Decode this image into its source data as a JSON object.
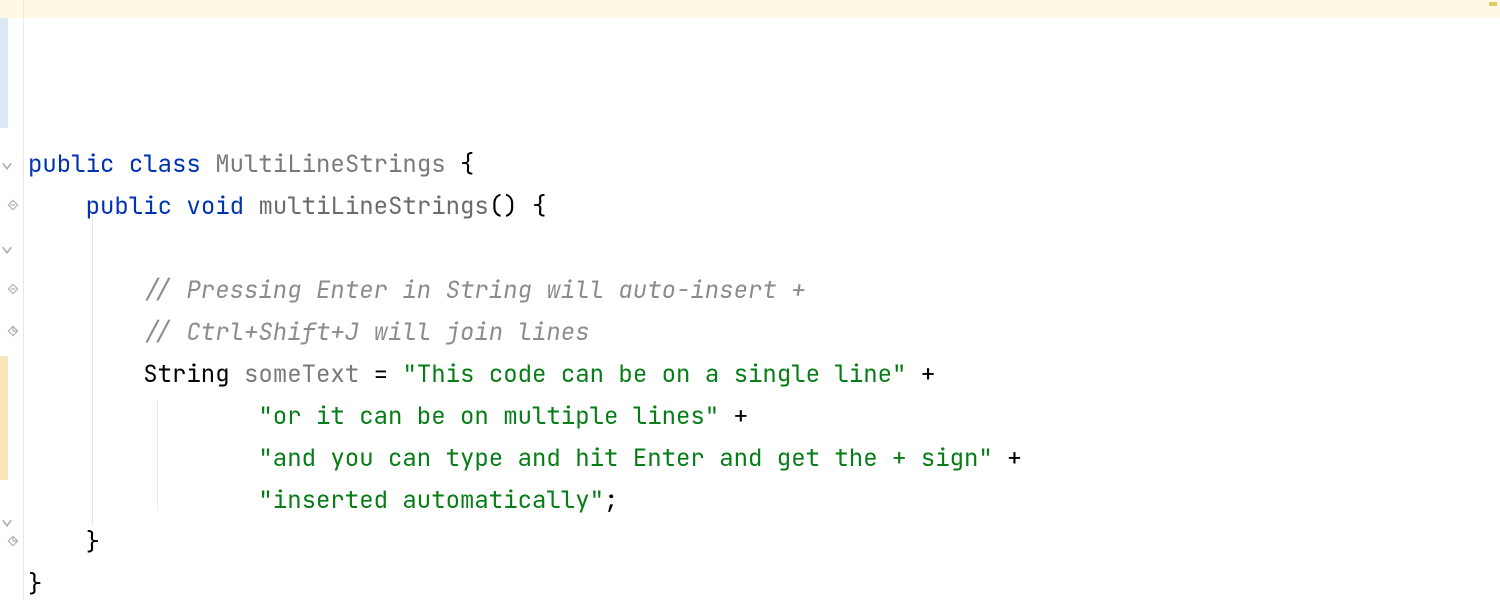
{
  "code": {
    "line1": {
      "kw_public": "public",
      "kw_class": "class",
      "class_name": "MultiLineStrings",
      "brace_open": "{"
    },
    "line2": {
      "kw_public": "public",
      "kw_void": "void",
      "method_name": "multiLineStrings",
      "parens": "()",
      "brace_open": "{"
    },
    "line3_comment": "// Pressing Enter in String will auto-insert +",
    "line4_comment": "// Ctrl+Shift+J will join lines",
    "line5": {
      "type": "String",
      "var": "someText",
      "eq": "=",
      "str": "\"This code can be on a single line\"",
      "plus": "+"
    },
    "line6": {
      "str": "\"or it can be on multiple lines\"",
      "plus": "+"
    },
    "line7": {
      "str": "\"and you can type and hit Enter and get the + sign\"",
      "plus": "+"
    },
    "line8": {
      "str": "\"inserted automatically\"",
      "semi": ";"
    },
    "line9_brace": "}",
    "line10_brace": "}"
  }
}
